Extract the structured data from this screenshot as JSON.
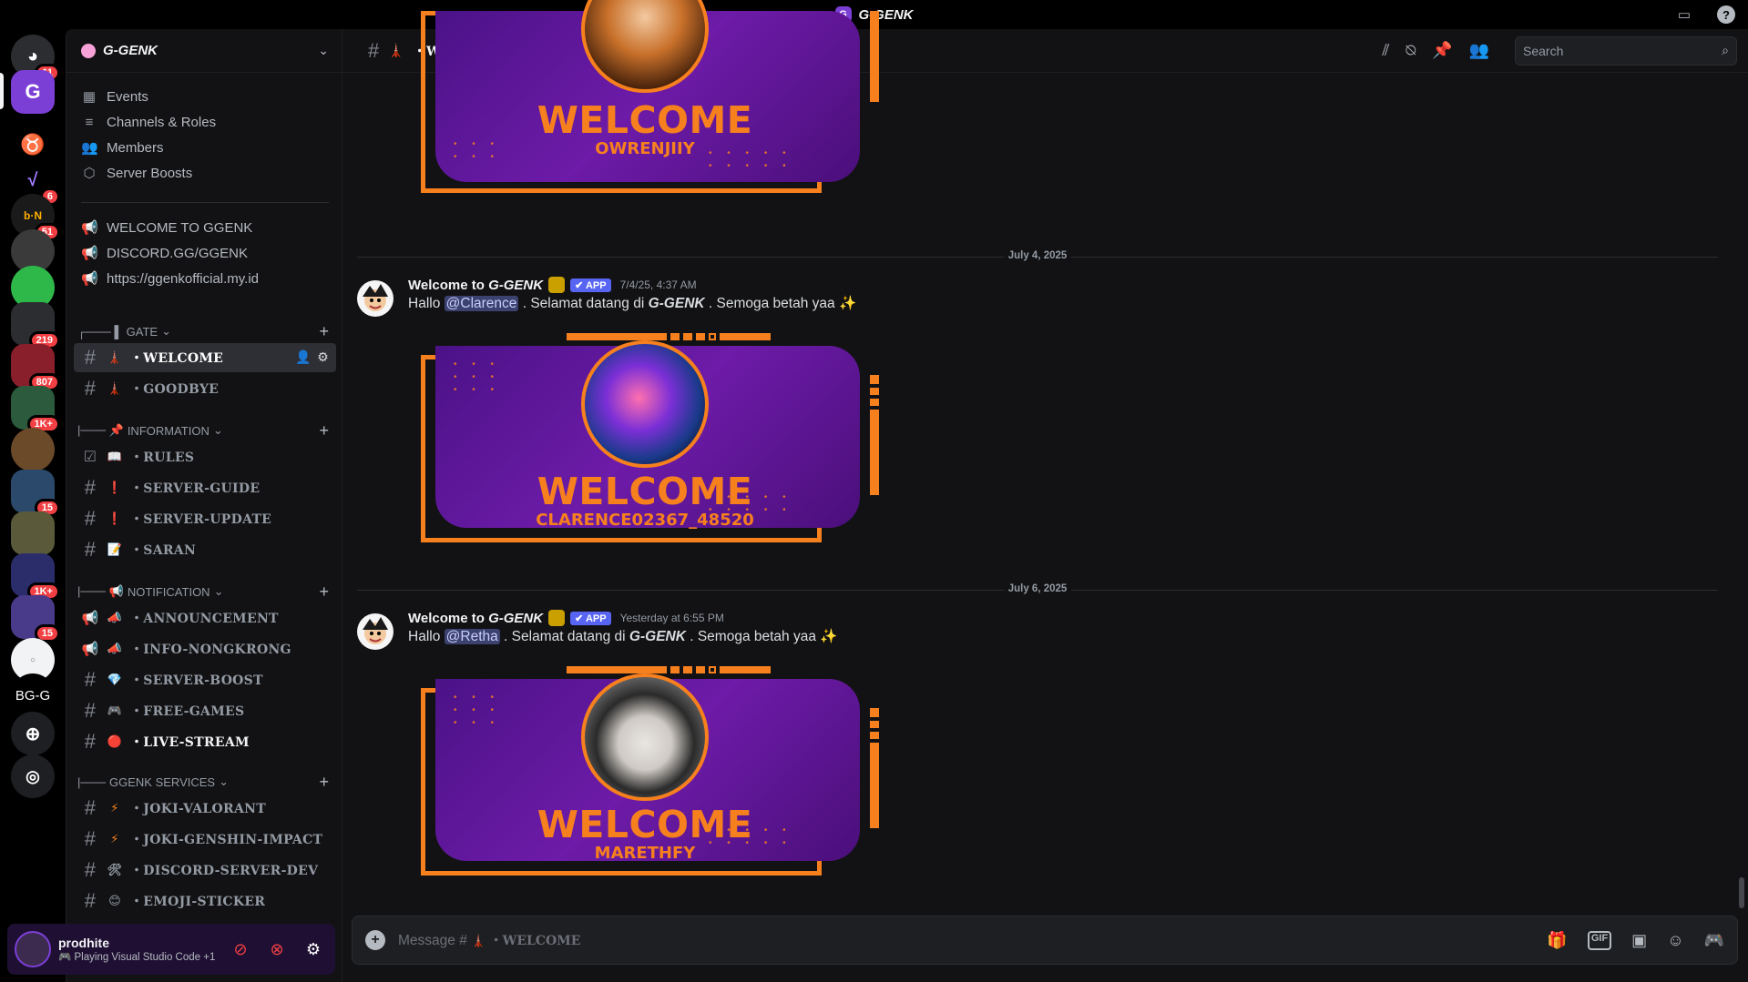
{
  "window": {
    "title": "G-GENK"
  },
  "rail": {
    "servers": [
      {
        "name": "direct-messages",
        "badge": "11"
      },
      {
        "name": "g-genk",
        "badge": ""
      },
      {
        "name": "server-3",
        "badge": ""
      },
      {
        "name": "server-4",
        "badge": "6"
      },
      {
        "name": "server-5",
        "badge": "51"
      },
      {
        "name": "server-6",
        "badge": ""
      },
      {
        "name": "server-7",
        "badge": ""
      },
      {
        "name": "folder-1",
        "badge": "219"
      },
      {
        "name": "folder-2",
        "badge": "807"
      },
      {
        "name": "folder-3",
        "badge": "1K+"
      },
      {
        "name": "server-8",
        "badge": ""
      },
      {
        "name": "folder-4",
        "badge": "15"
      },
      {
        "name": "folder-5",
        "badge": ""
      },
      {
        "name": "folder-6",
        "badge": "1K+"
      },
      {
        "name": "folder-7",
        "badge": "15"
      },
      {
        "name": "server-9",
        "badge": ""
      },
      {
        "name": "bg-g",
        "label": "BG-G"
      }
    ]
  },
  "guild": {
    "name": "G-GENK",
    "nav": [
      {
        "label": "Events"
      },
      {
        "label": "Channels & Roles"
      },
      {
        "label": "Members"
      },
      {
        "label": "Server Boosts"
      }
    ],
    "announce_links": [
      {
        "label": "WELCOME TO GGENK"
      },
      {
        "label": "DISCORD.GG/GGENK"
      },
      {
        "label": "https://ggenkofficial.my.id"
      }
    ],
    "categories": {
      "gate": {
        "label": "GATE",
        "prefix": "┌─── ▌"
      },
      "information": {
        "label": "INFORMATION",
        "prefix": "|─── 📌"
      },
      "notification": {
        "label": "NOTIFICATION",
        "prefix": "|─── 📢"
      },
      "services": {
        "label": "GGENK SERVICES",
        "prefix": "|─── "
      }
    },
    "channels": {
      "gate": [
        {
          "emoji": "🗼",
          "label": "・WELCOME"
        },
        {
          "emoji": "🗼",
          "label": "・GOODBYE"
        }
      ],
      "information": [
        {
          "emoji": "📖",
          "label": "・RULES"
        },
        {
          "emoji": "❗",
          "label": "・SERVER-GUIDE"
        },
        {
          "emoji": "❗",
          "label": "・SERVER-UPDATE"
        },
        {
          "emoji": "📝",
          "label": "・SARAN"
        }
      ],
      "notification": [
        {
          "emoji": "📣",
          "label": "・ANNOUNCEMENT"
        },
        {
          "emoji": "📣",
          "label": "・INFO-NONGKRONG"
        },
        {
          "emoji": "💎",
          "label": "・SERVER-BOOST"
        },
        {
          "emoji": "🎮",
          "label": "・FREE-GAMES"
        },
        {
          "emoji": "🔴",
          "label": "・LIVE-STREAM"
        }
      ],
      "services": [
        {
          "emoji": "⚡",
          "label": "・JOKI-VALORANT"
        },
        {
          "emoji": "⚡",
          "label": "・JOKI-GENSHIN-IMPACT"
        },
        {
          "emoji": "🛠",
          "label": "・DISCORD-SERVER-DEV"
        },
        {
          "emoji": "😊",
          "label": "・EMOJI-STICKER"
        }
      ]
    }
  },
  "user": {
    "name": "prodhite",
    "status": "Playing Visual Studio Code +1"
  },
  "channel": {
    "name": "・WELCOME",
    "emoji": "🗼",
    "search_placeholder": "Search"
  },
  "messages": {
    "first_card_name": "OWRENJIIY",
    "items": [
      {
        "date": "July 4, 2025",
        "author_prefix": "Welcome to ",
        "author_brand": "G-GENK",
        "tag": "✔ APP",
        "time": "7/4/25, 4:37 AM",
        "hello": "Hallo ",
        "mention": "@Clarence",
        "text_mid": " . Selamat datang di ",
        "brand": "G-GENK",
        "text_end": " . Semoga betah yaa ",
        "card_title": "WELCOME",
        "card_name": "CLARENCE02367_48520"
      },
      {
        "date": "July 6, 2025",
        "author_prefix": "Welcome to ",
        "author_brand": "G-GENK",
        "tag": "✔ APP",
        "time": "Yesterday at 6:55 PM",
        "hello": "Hallo ",
        "mention": "@Retha",
        "text_mid": " . Selamat datang di ",
        "brand": "G-GENK",
        "text_end": " . Semoga betah yaa ",
        "card_title": "WELCOME",
        "card_name": "MARETHFY"
      }
    ]
  },
  "composer": {
    "placeholder_prefix": "Message #",
    "placeholder_channel": "・WELCOME"
  },
  "colors": {
    "accent_orange": "#f7801e",
    "card_purple": "#6d1ba8",
    "badge_red": "#f23f43",
    "app_blue": "#5865f2"
  }
}
